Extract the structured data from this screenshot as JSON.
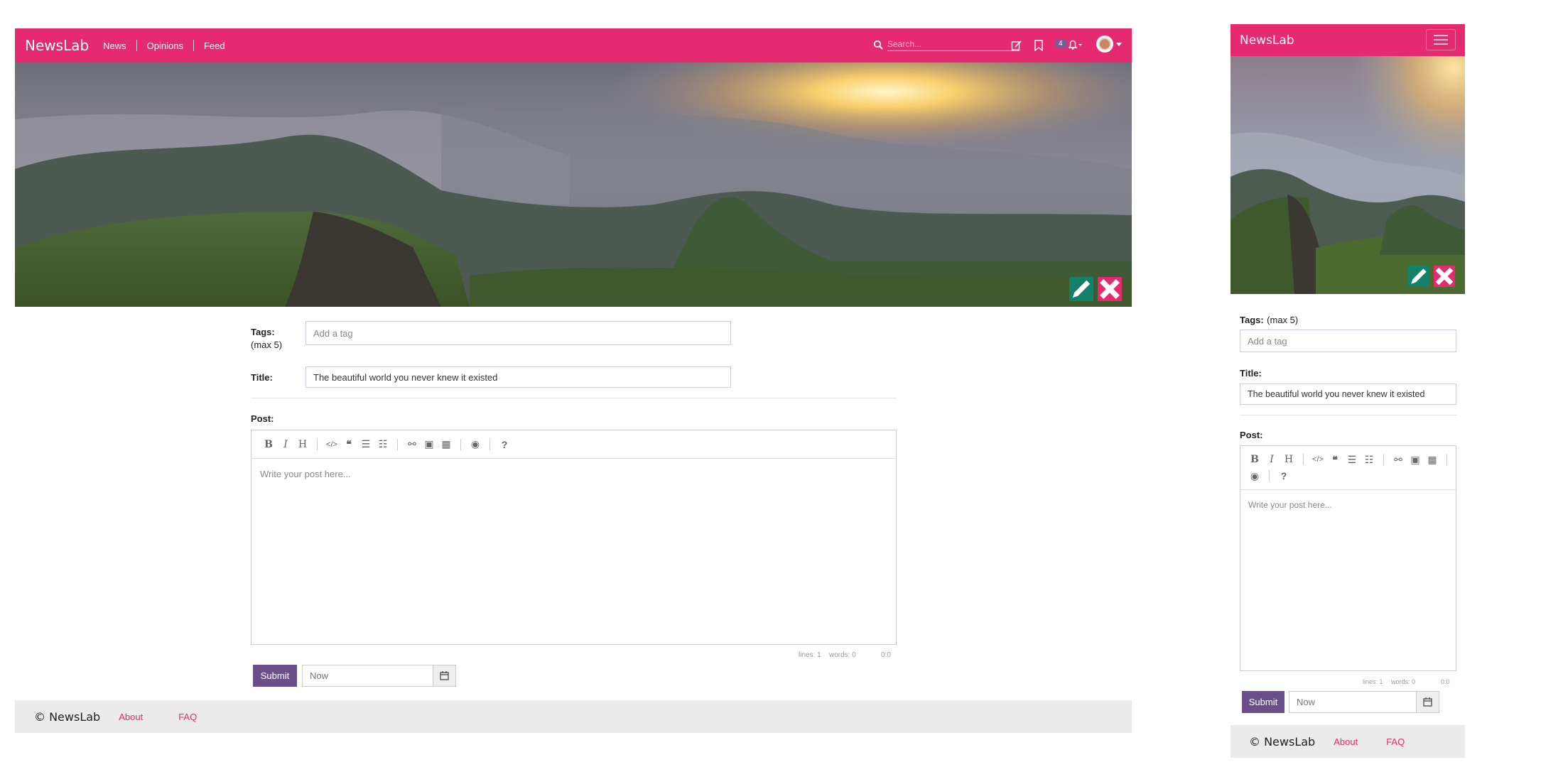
{
  "app": {
    "brand": "NewsLab"
  },
  "nav": {
    "links": [
      "News",
      "Opinions",
      "Feed"
    ],
    "search_placeholder": "Search...",
    "notif_count": "4"
  },
  "form": {
    "tags_label": "Tags:",
    "tags_sub": "(max 5)",
    "tags_placeholder": "Add a tag",
    "title_label": "Title:",
    "title_value": "The beautiful world you never knew it existed",
    "post_label": "Post:",
    "post_placeholder": "Write your post here...",
    "status_lines": "lines: 1",
    "status_words": "words: 0",
    "status_pos": "0:0",
    "submit_label": "Submit",
    "date_placeholder": "Now"
  },
  "footer": {
    "copyright": "© NewsLab",
    "links": [
      "About",
      "FAQ"
    ]
  },
  "colors": {
    "brand": "#e52a6f",
    "edit": "#15806a",
    "submit": "#6b4f8a",
    "footer_bg": "#ebebeb"
  },
  "icons": [
    "search-icon",
    "edit-icon",
    "bookmark-icon",
    "bell-icon",
    "avatar",
    "pencil-icon",
    "close-icon",
    "bold-icon",
    "italic-icon",
    "heading-icon",
    "code-icon",
    "quote-icon",
    "bullet-list-icon",
    "numbered-list-icon",
    "link-icon",
    "image-icon",
    "table-icon",
    "preview-icon",
    "help-icon",
    "calendar-icon",
    "hamburger-icon"
  ]
}
